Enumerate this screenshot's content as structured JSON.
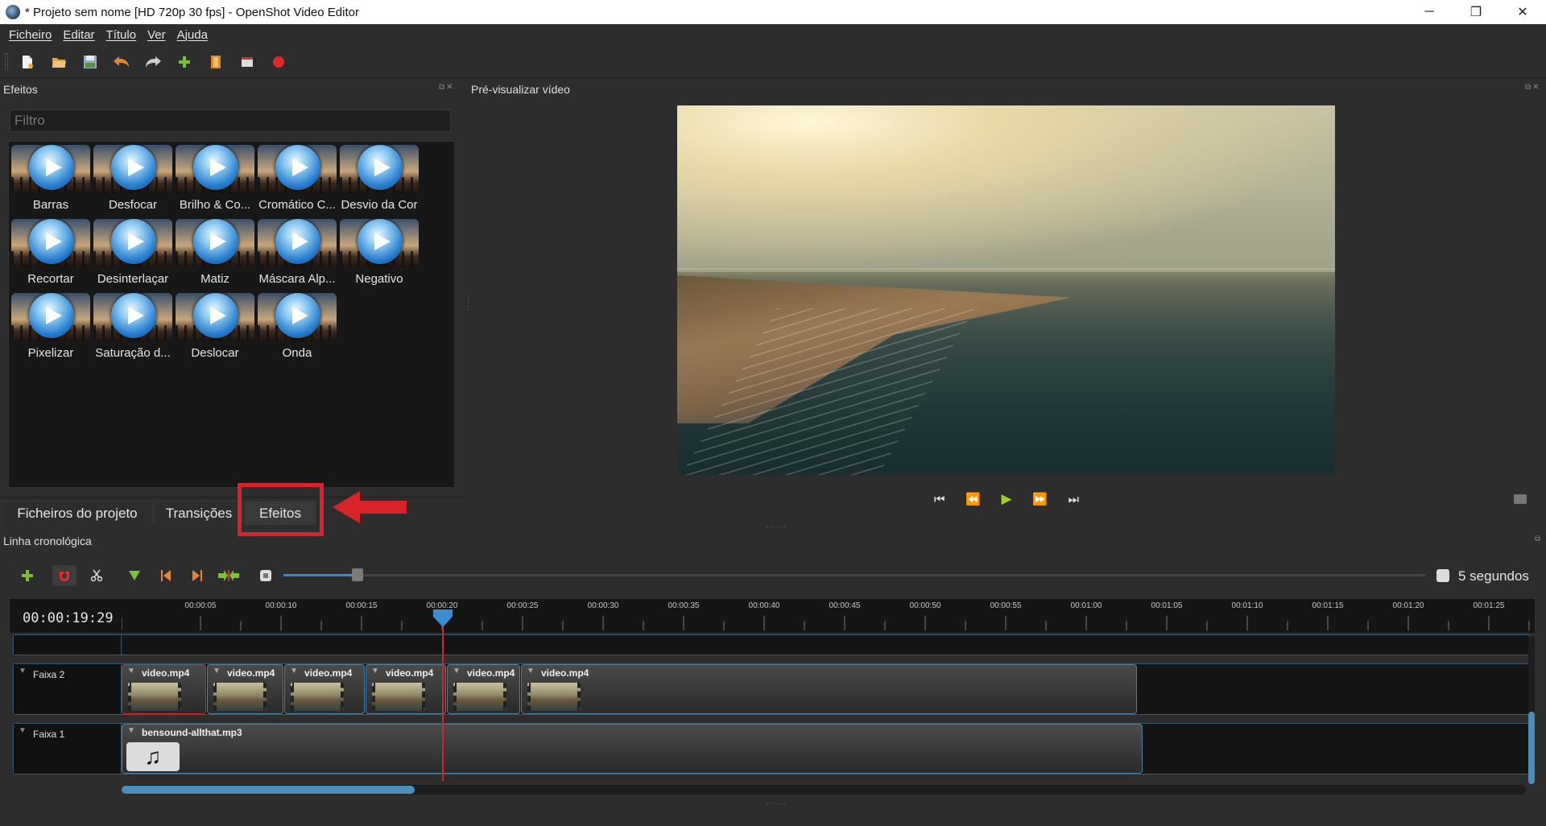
{
  "window": {
    "title": "* Projeto sem nome [HD 720p 30 fps] - OpenShot Video Editor",
    "controls": [
      "─",
      "❐",
      "✕"
    ]
  },
  "menu": [
    "Ficheiro",
    "Editar",
    "Título",
    "Ver",
    "Ajuda"
  ],
  "effects_panel": {
    "title": "Efeitos",
    "filter_placeholder": "Filtro",
    "items": [
      "Barras",
      "Desfocar",
      "Brilho & Co...",
      "Cromático C...",
      "Desvio da Cor",
      "Recortar",
      "Desinterlaçar",
      "Matiz",
      "Máscara Alp...",
      "Negativo",
      "Pixelizar",
      "Saturação d...",
      "Deslocar",
      "Onda"
    ]
  },
  "bottom_tabs": [
    "Ficheiros do projeto",
    "Transições",
    "Efeitos"
  ],
  "preview": {
    "title": "Pré-visualizar vídeo"
  },
  "timeline": {
    "title": "Linha cronológica",
    "zoom_label": "5 segundos",
    "zoom_level": 0.06,
    "current_time": "00:00:19:29",
    "ruler_labels": [
      "00:00:05",
      "00:00:10",
      "00:00:15",
      "00:00:20",
      "00:00:25",
      "00:00:30",
      "00:00:35",
      "00:00:40",
      "00:00:45",
      "00:00:50",
      "00:00:55",
      "00:01:00",
      "00:01:05",
      "00:01:10",
      "00:01:15",
      "00:01:20",
      "00:01:25"
    ],
    "tracks": [
      {
        "name": "Faixa 2",
        "clips": [
          "video.mp4",
          "video.mp4",
          "video.mp4",
          "video.mp4",
          "video.mp4",
          "video.mp4"
        ]
      },
      {
        "name": "Faixa 1",
        "clips": [
          "bensound-allthat.mp3"
        ]
      }
    ]
  },
  "colors": {
    "accent_red": "#d9232b",
    "accent_blue": "#3d88c7",
    "play_green": "#9ad22f"
  }
}
